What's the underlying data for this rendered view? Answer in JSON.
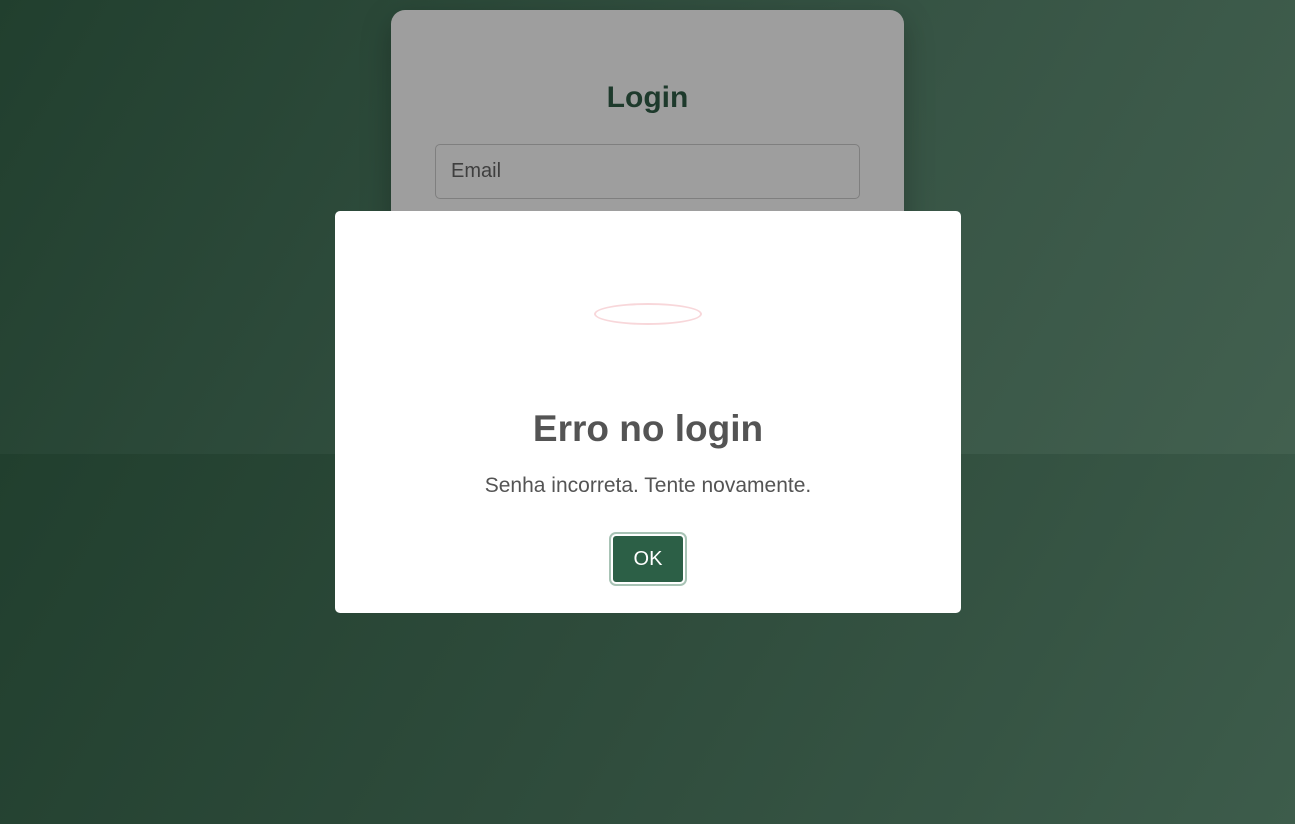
{
  "login": {
    "title": "Login",
    "email_placeholder": "Email"
  },
  "dialog": {
    "icon": "error-icon",
    "title": "Erro no login",
    "message": "Senha incorreta. Tente novamente.",
    "ok_label": "OK"
  },
  "colors": {
    "background": "#2c4a3a",
    "accent": "#2c5f46",
    "error_icon": "#f8d7da"
  }
}
